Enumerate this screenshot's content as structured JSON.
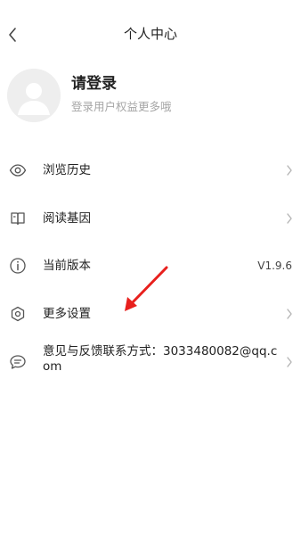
{
  "header": {
    "back_icon": "chevron-left-icon",
    "title": "个人中心"
  },
  "profile": {
    "avatar_icon": "default-avatar-icon",
    "login_title": "请登录",
    "login_subtitle": "登录用户权益更多哦"
  },
  "menu": {
    "items": [
      {
        "icon": "eye-icon",
        "label": "浏览历史",
        "has_chevron": true
      },
      {
        "icon": "book-icon",
        "label": "阅读基因",
        "has_chevron": true
      },
      {
        "icon": "info-icon",
        "label": "当前版本",
        "value": "V1.9.6",
        "has_chevron": false
      },
      {
        "icon": "hexagon-settings-icon",
        "label": "更多设置",
        "has_chevron": true
      },
      {
        "icon": "chat-bubble-icon",
        "label": "意见与反馈联系方式：3033480082@qq.com",
        "has_chevron": true
      }
    ]
  },
  "annotation": {
    "arrow_color": "#e8201d"
  },
  "colors": {
    "icon": "#555555",
    "chevron": "#b5b5b5",
    "subtitle": "#a6a6a6"
  }
}
